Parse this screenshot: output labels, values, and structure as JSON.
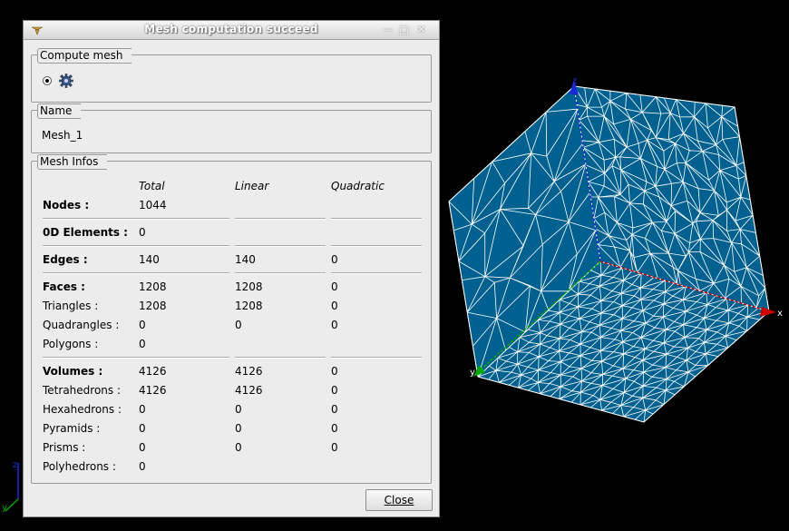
{
  "dialog": {
    "title": "Mesh computation succeed",
    "close_label": "Close"
  },
  "compute_mesh": {
    "label": "Compute mesh"
  },
  "name_group": {
    "label": "Name",
    "value": "Mesh_1"
  },
  "mesh_infos": {
    "label": "Mesh Infos",
    "columns": [
      "Total",
      "Linear",
      "Quadratic"
    ],
    "rows": [
      {
        "label": "Nodes :",
        "bold": true,
        "total": "1044",
        "linear": "",
        "quadratic": ""
      },
      {
        "label": "0D Elements :",
        "bold": true,
        "total": "0",
        "linear": "",
        "quadratic": ""
      },
      {
        "label": "Edges :",
        "bold": true,
        "total": "140",
        "linear": "140",
        "quadratic": "0"
      },
      {
        "label": "Faces :",
        "bold": true,
        "total": "1208",
        "linear": "1208",
        "quadratic": "0"
      },
      {
        "label": "Triangles :",
        "bold": false,
        "total": "1208",
        "linear": "1208",
        "quadratic": "0"
      },
      {
        "label": "Quadrangles :",
        "bold": false,
        "total": "0",
        "linear": "0",
        "quadratic": "0"
      },
      {
        "label": "Polygons :",
        "bold": false,
        "total": "0",
        "linear": "",
        "quadratic": ""
      },
      {
        "label": "Volumes :",
        "bold": true,
        "total": "4126",
        "linear": "4126",
        "quadratic": "0"
      },
      {
        "label": "Tetrahedrons :",
        "bold": false,
        "total": "4126",
        "linear": "4126",
        "quadratic": "0"
      },
      {
        "label": "Hexahedrons :",
        "bold": false,
        "total": "0",
        "linear": "0",
        "quadratic": "0"
      },
      {
        "label": "Pyramids :",
        "bold": false,
        "total": "0",
        "linear": "0",
        "quadratic": "0"
      },
      {
        "label": "Prisms :",
        "bold": false,
        "total": "0",
        "linear": "0",
        "quadratic": "0"
      },
      {
        "label": "Polyhedrons :",
        "bold": false,
        "total": "0",
        "linear": "",
        "quadratic": ""
      }
    ]
  },
  "viewer": {
    "axis_x": "x",
    "axis_y": "y",
    "axis_z": "z",
    "mesh_color": "#00608f",
    "edge_color": "#ffffff",
    "x_axis_color": "#cc0000",
    "y_axis_color": "#00aa00",
    "z_axis_color": "#1b2ad6"
  },
  "icons": {
    "app": "app-icon",
    "minimize": "minimize-icon",
    "maximize": "maximize-icon",
    "close": "close-icon",
    "compute": "gear-icon"
  }
}
